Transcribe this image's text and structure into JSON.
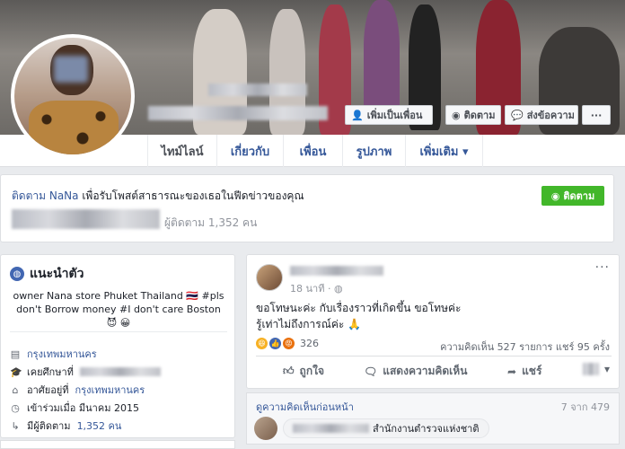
{
  "cover": {
    "add_friend_label": "เพิ่มเป็นเพื่อน",
    "follow_label": "ติดตาม",
    "message_label": "ส่งข้อความ",
    "more_label": "···"
  },
  "tabs": [
    {
      "label": "ไทม์ไลน์"
    },
    {
      "label": "เกี่ยวกับ"
    },
    {
      "label": "เพื่อน"
    },
    {
      "label": "รูปภาพ"
    },
    {
      "label": "เพิ่มเติม ▾"
    }
  ],
  "follow_card": {
    "prefix": "ติดตาม ",
    "name": "NaNa",
    "suffix": " เพื่อรับโพสต์สาธารณะของเธอในฟีดข่าวของคุณ",
    "button_label": "ติดตาม",
    "follower_text": "ผู้ติดตาม 1,352 คน"
  },
  "intro": {
    "title": "แนะนำตัว",
    "bio": "owner Nana store Phuket Thailand 🇹🇭 #pls don't Borrow money #I don't care Boston 😈 😀",
    "rows": [
      {
        "icon": "▤",
        "text": "กรุงเทพมหานคร",
        "link": true
      },
      {
        "icon": "🎓",
        "text": "เคยศึกษาที่",
        "link": false
      },
      {
        "icon": "⌂",
        "text": "อาศัยอยู่ที่ ",
        "extra": "กรุงเทพมหานคร",
        "link": false
      },
      {
        "icon": "◷",
        "text": "เข้าร่วมเมื่อ มีนาคม 2015",
        "link": false
      },
      {
        "icon": "↳",
        "text": "มีผู้ติดตาม ",
        "extra": "1,352 คน",
        "link": false
      }
    ]
  },
  "post": {
    "time": "18 นาที · ",
    "privacy_icon": "◍",
    "line1": "ขอโทษนะค่ะ กับเรื่องราวที่เกิดขึ้น ขอโทษค่ะ",
    "line2": "รู้เท่าไม่ถึงการณ์ค่ะ 🙏",
    "reaction_count": "326",
    "stats": "ความคิดเห็น 527 รายการ  แชร์ 95 ครั้ง",
    "like_label": "ถูกใจ",
    "comment_label": "แสดงความคิดเห็น",
    "share_label": "แชร์",
    "more": "···"
  },
  "comments": {
    "prev_label": "ดูความคิดเห็นก่อนหน้า",
    "count": "7 จาก 479",
    "first_comment_text": "สำนักงานตำรวจแห่งชาติ"
  },
  "colors": {
    "link": "#365899",
    "green": "#42b72a",
    "bg": "#e9ebee"
  }
}
